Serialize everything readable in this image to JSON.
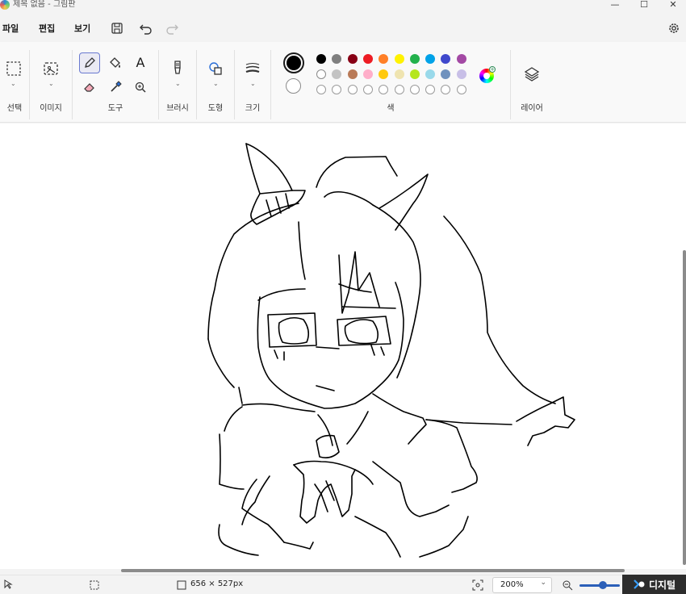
{
  "window": {
    "title": "제목 없음 - 그림판",
    "minimize": "—",
    "maximize": "☐",
    "close": "✕"
  },
  "menu": {
    "file": "파일",
    "edit": "편집",
    "view": "보기"
  },
  "ribbon": {
    "select_label": "선택",
    "image_label": "이미지",
    "tools_label": "도구",
    "text_tool": "A",
    "brush_label": "브러시",
    "shape_label": "도형",
    "size_label": "크기",
    "colors_label": "색",
    "layers_label": "레이어",
    "palette": {
      "row1": [
        "#000000",
        "#7f7f7f",
        "#880015",
        "#ed1c24",
        "#ff7f27",
        "#fff200",
        "#22b14c",
        "#00a2e8",
        "#3f48cc",
        "#a349a4"
      ],
      "row2": [
        "#ffffff",
        "#c3c3c3",
        "#b97a57",
        "#ffaec9",
        "#ffc90e",
        "#efe4b0",
        "#b5e61d",
        "#99d9ea",
        "#7092be",
        "#c8bfe7"
      ]
    },
    "primary_color": "#000000",
    "secondary_color": "#ffffff",
    "accent_color": "#6a7ad0"
  },
  "status": {
    "canvas_size": "656 × 527px",
    "zoom": "200%"
  },
  "watermark": {
    "text": "디지털"
  }
}
